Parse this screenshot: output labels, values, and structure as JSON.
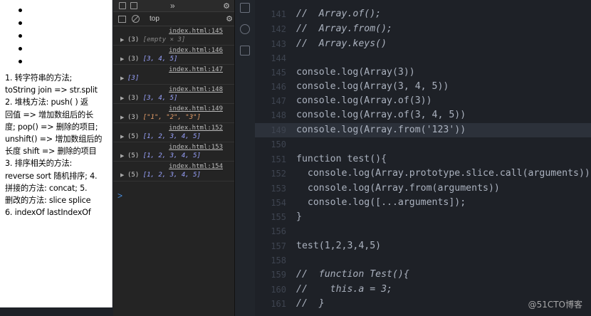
{
  "page": {
    "bullets": [
      "",
      "",
      "",
      "",
      ""
    ],
    "notes": [
      "1. 转字符串的方法;",
      "toString join => str.split",
      "2. 堆栈方法:  push( ) 返",
      "回值 => 增加数组后的长",
      "度; pop() => 删除的项目;",
      "unshift() => 增加数组后的",
      "长度 shift => 删除的项目",
      "3. 排序相关的方法:",
      "reverse sort 随机排序; 4.",
      "拼接的方法:  concat; 5.",
      "删改的方法:  slice splice",
      "6. indexOf lastIndexOf"
    ]
  },
  "devtools": {
    "toolbar": {
      "more": "»",
      "settings_icon": "gear-icon"
    },
    "console_bar": {
      "context": "top"
    },
    "logs": [
      {
        "source": "index.html:145",
        "count": "(3)",
        "value": "[empty × 3]"
      },
      {
        "source": "index.html:146",
        "count": "(3)",
        "value": "[3, 4, 5]"
      },
      {
        "source": "index.html:147",
        "count": "",
        "value": "[3]"
      },
      {
        "source": "index.html:148",
        "count": "(3)",
        "value": "[3, 4, 5]"
      },
      {
        "source": "index.html:149",
        "count": "(3)",
        "value": "[\"1\", \"2\", \"3\"]"
      },
      {
        "source": "index.html:152",
        "count": "(5)",
        "value": "[1, 2, 3, 4, 5]"
      },
      {
        "source": "index.html:153",
        "count": "(5)",
        "value": "[1, 2, 3, 4, 5]"
      },
      {
        "source": "index.html:154",
        "count": "(5)",
        "value": "[1, 2, 3, 4, 5]"
      }
    ],
    "prompt": ">"
  },
  "editor": {
    "lines": [
      {
        "n": "141",
        "text": "//  Array.of();"
      },
      {
        "n": "142",
        "text": "//  Array.from();"
      },
      {
        "n": "143",
        "text": "//  Array.keys()"
      },
      {
        "n": "144",
        "text": ""
      },
      {
        "n": "145",
        "text": "console.log(Array(3))"
      },
      {
        "n": "146",
        "text": "console.log(Array(3, 4, 5))"
      },
      {
        "n": "147",
        "text": "console.log(Array.of(3))"
      },
      {
        "n": "148",
        "text": "console.log(Array.of(3, 4, 5))"
      },
      {
        "n": "149",
        "text": "console.log(Array.from('123'))"
      },
      {
        "n": "150",
        "text": ""
      },
      {
        "n": "151",
        "text": "function test(){"
      },
      {
        "n": "152",
        "text": "  console.log(Array.prototype.slice.call(arguments))"
      },
      {
        "n": "153",
        "text": "  console.log(Array.from(arguments))"
      },
      {
        "n": "154",
        "text": "  console.log([...arguments]);"
      },
      {
        "n": "155",
        "text": "}"
      },
      {
        "n": "156",
        "text": ""
      },
      {
        "n": "157",
        "text": "test(1,2,3,4,5)"
      },
      {
        "n": "158",
        "text": ""
      },
      {
        "n": "159",
        "text": "//  function Test(){"
      },
      {
        "n": "160",
        "text": "//    this.a = 3;"
      },
      {
        "n": "161",
        "text": "//  }"
      }
    ]
  },
  "watermark": "@51CTO博客"
}
